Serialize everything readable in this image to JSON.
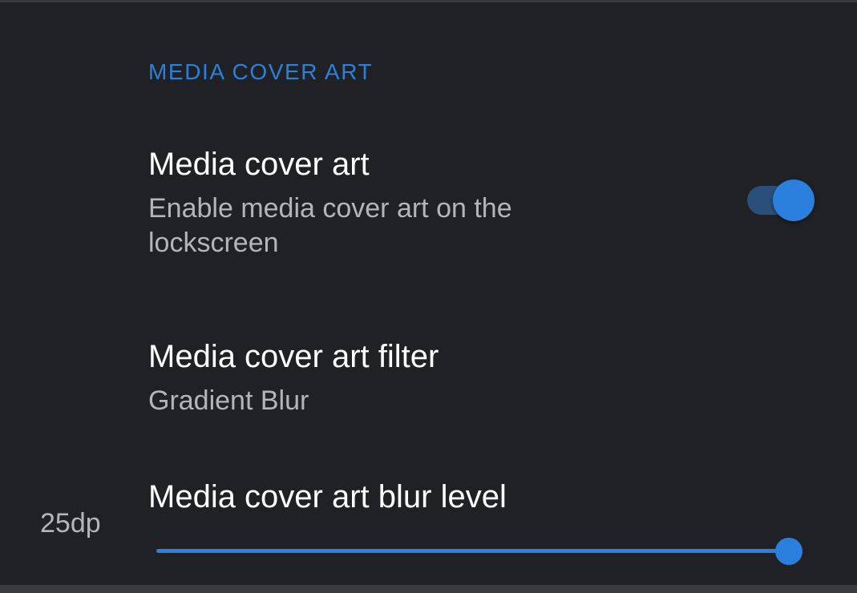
{
  "section": {
    "header": "MEDIA COVER ART"
  },
  "preferences": {
    "cover_art": {
      "title": "Media cover art",
      "summary": "Enable media cover art on the lockscreen",
      "enabled": true
    },
    "filter": {
      "title": "Media cover art filter",
      "summary": "Gradient Blur"
    },
    "blur_level": {
      "title": "Media cover art blur level",
      "value_label": "25dp",
      "value_fraction": 1.0
    }
  },
  "colors": {
    "accent": "#2b7fdd",
    "background": "#202124",
    "title_text": "#ffffff",
    "summary_text": "#b3b5b8"
  }
}
